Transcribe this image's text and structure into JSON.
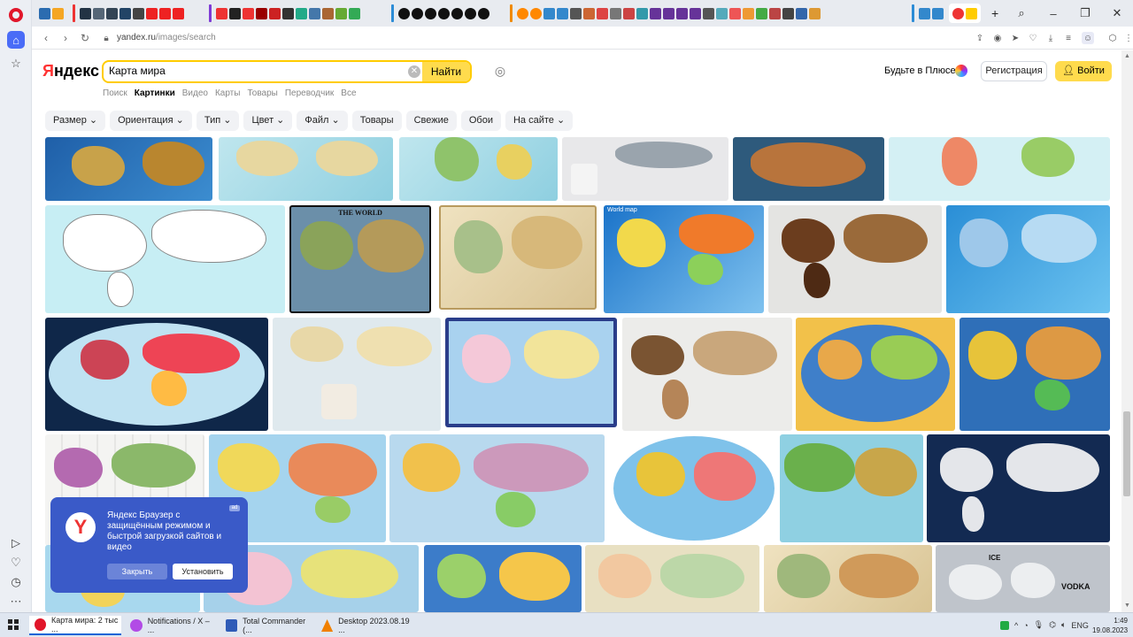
{
  "browser": {
    "url_host": "yandex.ru",
    "url_path": "/images/search"
  },
  "header": {
    "logo": "Яндекс",
    "search_value": "Карта мира",
    "search_button": "Найти",
    "plus_text": "Будьте в Плюсе",
    "register_button": "Регистрация",
    "login_button": "Войти"
  },
  "services": [
    "Поиск",
    "Картинки",
    "Видео",
    "Карты",
    "Товары",
    "Переводчик",
    "Все"
  ],
  "filters": [
    "Размер",
    "Ориентация",
    "Тип",
    "Цвет",
    "Файл",
    "Товары",
    "Свежие",
    "Обои",
    "На сайте"
  ],
  "popup": {
    "logo_letter": "Y",
    "text": "Яндекс Браузер с защищённым режимом и быстрой загрузкой сайтов и видео",
    "badge": "ad",
    "close_button": "Закрыть",
    "install_button": "Установить"
  },
  "taskbar": {
    "tasks": [
      {
        "label": "Карта мира: 2 тыс ...",
        "color": "#e1162a"
      },
      {
        "label": "Notifications / X – ...",
        "color": "#b24be6"
      },
      {
        "label": "Total Commander (...",
        "color": "#2f5bb7"
      },
      {
        "label": "Desktop 2023.08.19 ...",
        "color": "#f08000"
      }
    ],
    "lang": "ENG",
    "time": "1:49",
    "date": "19.08.2023"
  },
  "tile_labels": {
    "the_world": "THE WORLD",
    "world_map": "World map",
    "ice": "ICE",
    "vodka": "VODKA"
  }
}
